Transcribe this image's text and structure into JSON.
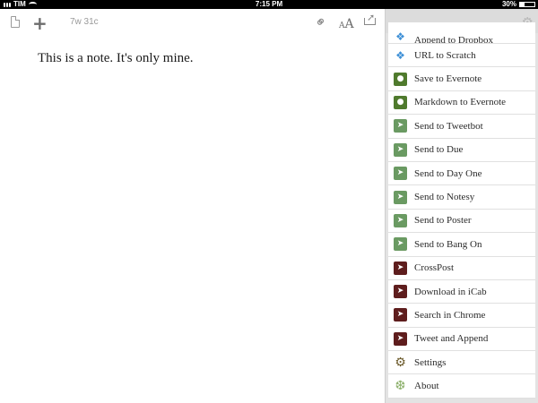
{
  "status_bar": {
    "carrier": "TIM",
    "time": "7:15 PM",
    "battery": "30%"
  },
  "editor": {
    "count": "7w 31c",
    "font_small": "A",
    "font_big": "A",
    "note": "This is a note.  It's only mine."
  },
  "panel": {
    "items": [
      {
        "label": "Append to Dropbox",
        "icon": "dropbox-icon"
      },
      {
        "label": "URL to Scratch",
        "icon": "dropbox-icon"
      },
      {
        "label": "Save to Evernote",
        "icon": "evernote-icon"
      },
      {
        "label": "Markdown to Evernote",
        "icon": "evernote-icon"
      },
      {
        "label": "Send to Tweetbot",
        "icon": "arrow-green-icon"
      },
      {
        "label": "Send to Due",
        "icon": "arrow-green-icon"
      },
      {
        "label": "Send to Day One",
        "icon": "arrow-green-icon"
      },
      {
        "label": "Send to Notesy",
        "icon": "arrow-green-icon"
      },
      {
        "label": "Send to Poster",
        "icon": "arrow-green-icon"
      },
      {
        "label": "Send to Bang On",
        "icon": "arrow-green-icon"
      },
      {
        "label": "CrossPost",
        "icon": "arrow-maroon-icon"
      },
      {
        "label": "Download in iCab",
        "icon": "arrow-maroon-icon"
      },
      {
        "label": "Search in Chrome",
        "icon": "arrow-maroon-icon"
      },
      {
        "label": "Tweet and Append",
        "icon": "arrow-maroon-icon"
      },
      {
        "label": "Settings",
        "icon": "gear-icon"
      },
      {
        "label": "About",
        "icon": "about-icon"
      }
    ]
  }
}
